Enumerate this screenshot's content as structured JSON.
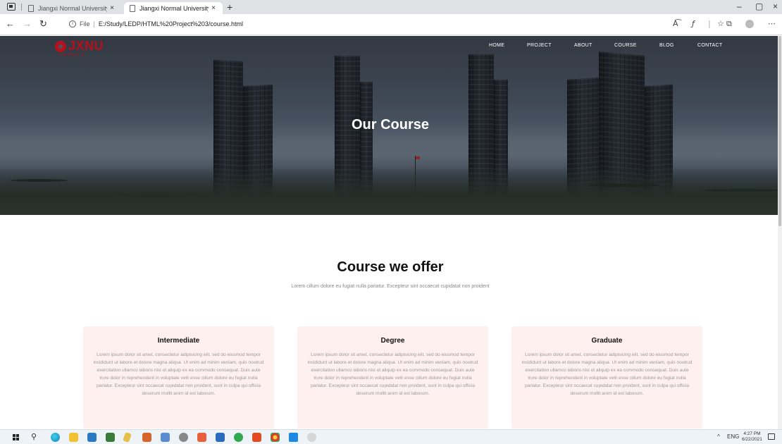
{
  "browser": {
    "tabs": [
      {
        "label": "Jiangxi Normal University",
        "active": false
      },
      {
        "label": "Jiangxi Normal University",
        "active": true
      }
    ],
    "new_tab": "+",
    "url_info": "File",
    "url": "E:/Study/LEDP/HTML%20Project%203/course.html",
    "window_controls": {
      "minimize": "–",
      "maximize": "▢",
      "close": "×"
    }
  },
  "site": {
    "logo": {
      "name": "JXNU",
      "sub": "江 西 师 范 大 学"
    },
    "nav": [
      "HOME",
      "PROJECT",
      "ABOUT",
      "COURSE",
      "BLOG",
      "CONTACT"
    ],
    "hero_title": "Our Course"
  },
  "section": {
    "title": "Course we offer",
    "subtitle": "Lorem cillum dolore eu fugiat nulla pariatur. Excepteur sint occaecat cupidatat non proident"
  },
  "cards": [
    {
      "title": "Intermediate",
      "body": "Lorem ipsum dolor sit amet, consectetur adipisicing elit, sed do eiusmod tempor incididunt ut labore et dolore magna aliqua. Ut enim ad minim veniam, quis nostrud exercitation ullamco laboris nisi ut aliquip ex ea commodo consequat. Duis aute irure dolor in reprehenderit in voluptate velit esse cillum dolore eu fugiat nulla pariatur. Excepteur sint occaecat cupidatat non proident, sunt in culpa qui officia deserunt mollit anim id est laborum."
    },
    {
      "title": "Degree",
      "body": "Lorem ipsum dolor sit amet, consectetur adipisicing elit, sed do eiusmod tempor incididunt ut labore et dolore magna aliqua. Ut enim ad minim veniam, quis nostrud exercitation ullamco laboris nisi ut aliquip ex ea commodo consequat. Duis aute irure dolor in reprehenderit in voluptate velit esse cillum dolore eu fugiat nulla pariatur. Excepteur sint occaecat cupidatat non proident, sunt in culpa qui officia deserunt mollit anim id est laborum."
    },
    {
      "title": "Graduate",
      "body": "Lorem ipsum dolor sit amet, consectetur adipisicing elit, sed do eiusmod tempor incididunt ut labore et dolore magna aliqua. Ut enim ad minim veniam, quis nostrud exercitation ullamco laboris nisi ut aliquip ex ea commodo consequat. Duis aute irure dolor in reprehenderit in voluptate velit esse cillum dolore eu fugiat nulla pariatur. Excepteur sint occaecat cupidatat non proident, sunt in culpa qui officia deserunt mollit anim id est laborum."
    }
  ],
  "taskbar": {
    "language": "ENG",
    "time": "4:27 PM",
    "date": "6/22/2021"
  },
  "colors": {
    "brand_red": "#b5101c",
    "card_bg": "#fdf0ef"
  }
}
